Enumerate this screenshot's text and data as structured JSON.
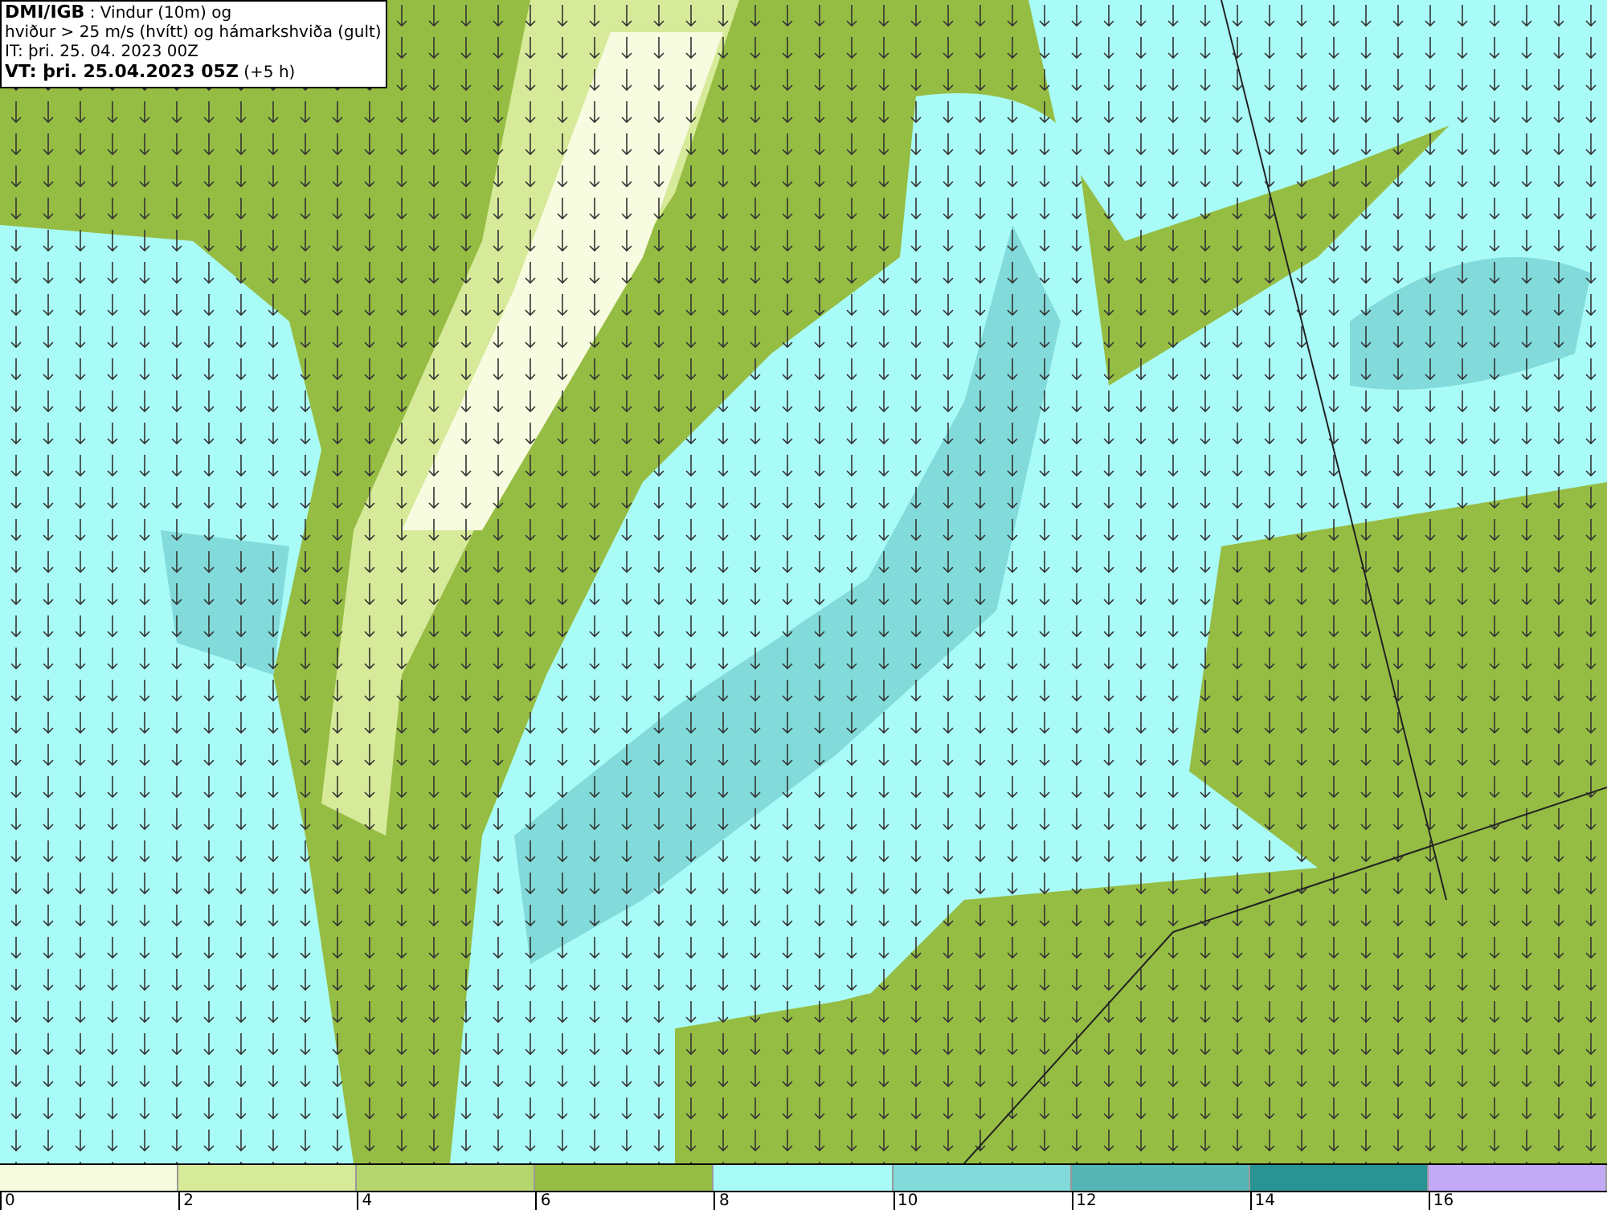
{
  "title_box": {
    "lines": [
      "**DMI/IGB** : Vindur (10m) og",
      "hviður > 25 m/s (hvítt) og hámarkshviða (gult)",
      "IT: þri. 25. 04. 2023 00Z",
      "**VT: þri. 25.04.2023 05Z** (+5 h)"
    ]
  },
  "legend": {
    "segments": [
      {
        "color": "#f7fbe0"
      },
      {
        "color": "#d7ea9a"
      },
      {
        "color": "#b5d66f"
      },
      {
        "color": "#96bd43"
      },
      {
        "color": "#a9fbf7"
      },
      {
        "color": "#82dada"
      },
      {
        "color": "#56b5b5"
      },
      {
        "color": "#2a9494"
      },
      {
        "color": "#c3aaf7"
      }
    ],
    "labels": [
      "0",
      "2",
      "4",
      "6",
      "8",
      "10",
      "12",
      "14",
      "16"
    ]
  }
}
